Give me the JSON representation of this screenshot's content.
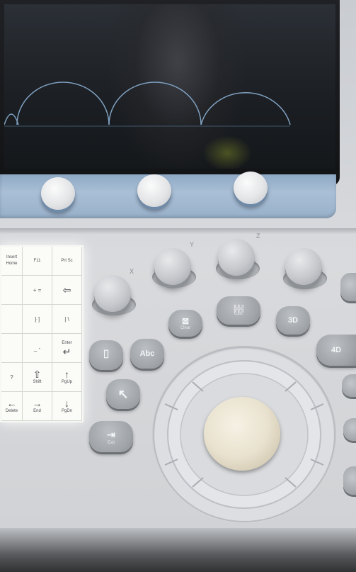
{
  "keyboard": {
    "rows": [
      [
        "",
        "F11",
        "Prt Sc"
      ],
      [
        "",
        "+ =",
        "backspace"
      ],
      [
        "",
        "} ]",
        "| \\"
      ],
      [
        "",
        "_ -",
        "Enter"
      ],
      [
        "?",
        "Shift",
        "PgUp"
      ],
      [
        "←",
        "End",
        "PgDn"
      ]
    ],
    "left_partial_labels": [
      "Insert Home",
      "Delete"
    ],
    "enter_arrow": "↵",
    "shift_arrow": "⇧",
    "up_arrow": "↑",
    "right_arrow": "→",
    "down_arrow": "↓",
    "backspace_arrow": "⇦"
  },
  "buttons": {
    "clear_label": "Clear",
    "calc_label": "Calc",
    "btn_3d": "3D",
    "btn_4d": "4D",
    "abc": "Abc",
    "exit_label": "Exit",
    "arrow_glyph": "↖",
    "caliper_glyph": "⊠",
    "calc_glyph": "╠╬╣",
    "body_marker_glyph": "⌷"
  },
  "knob_labels": {
    "x": "X",
    "y": "Y",
    "z": "Z"
  },
  "colors": {
    "screen_arc": "#7fa0c0",
    "knob_bar": "#a9bfd6",
    "console": "#d8dadd",
    "button_grey": "#a2a6ab"
  },
  "icons": {
    "screen_waveform": "arc-waveform-icon"
  }
}
